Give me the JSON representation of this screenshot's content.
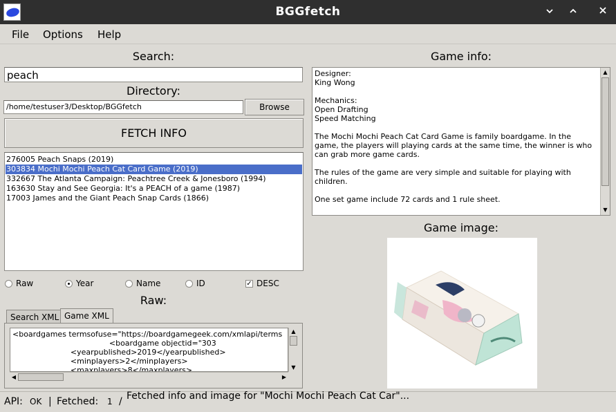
{
  "window": {
    "title": "BGGfetch"
  },
  "menu": {
    "file": "File",
    "options": "Options",
    "help": "Help"
  },
  "search": {
    "label": "Search:",
    "value": "peach"
  },
  "directory": {
    "label": "Directory:",
    "value": "/home/testuser3/Desktop/BGGfetch",
    "browse_label": "Browse"
  },
  "fetch_button": "FETCH INFO",
  "results": {
    "items": [
      "276005 Peach Snaps (2019)",
      "303834 Mochi Mochi Peach Cat Card Game (2019)",
      "332667 The Atlanta Campaign: Peachtree Creek & Jonesboro (1994)",
      "163630 Stay and See Georgia: It's a PEACH of a game (1987)",
      "17003 James and the Giant Peach Snap Cards (1866)"
    ],
    "selected_index": 1
  },
  "sort": {
    "raw": "Raw",
    "year": "Year",
    "name": "Name",
    "id": "ID",
    "desc": "DESC",
    "selected": "Year",
    "desc_checked": true
  },
  "raw": {
    "label": "Raw:",
    "tabs": [
      "Search XML",
      "Game XML"
    ],
    "active_tab": "Game XML",
    "lines": [
      "<boardgames termsofuse=\"https://boardgamegeek.com/xmlapi/terms",
      "                                        <boardgame objectid=\"303",
      "                        <yearpublished>2019</yearpublished>",
      "                        <minplayers>2</minplayers>",
      "                        <maxplayers>8</maxplayers>"
    ]
  },
  "game_info": {
    "label": "Game info:",
    "designer_heading": "Designer:",
    "designer": "King Wong",
    "mechanics_heading": "Mechanics:",
    "mechanics": [
      "Open Drafting",
      "Speed Matching"
    ],
    "description_1": "The Mochi Mochi Peach Cat Card Game is family boardgame. In the game, the players will playing cards at the same time, the winner is who can grab more game cards.",
    "description_2": "The rules of the game are very simple and suitable for playing with children.",
    "description_3": "One set game include 72 cards and 1 rule sheet."
  },
  "game_image": {
    "label": "Game image:"
  },
  "status": {
    "api_label": "API:",
    "api_value": "OK",
    "fetched_label": "Fetched:",
    "fetched_value": "1",
    "message": "Fetched info and image for \"Mochi Mochi Peach Cat Car\"..."
  },
  "colors": {
    "titlebar": "#2f2f2f",
    "window_bg": "#dcdad5",
    "selection": "#4a6ec9",
    "icon_blue": "#2a48e0"
  }
}
